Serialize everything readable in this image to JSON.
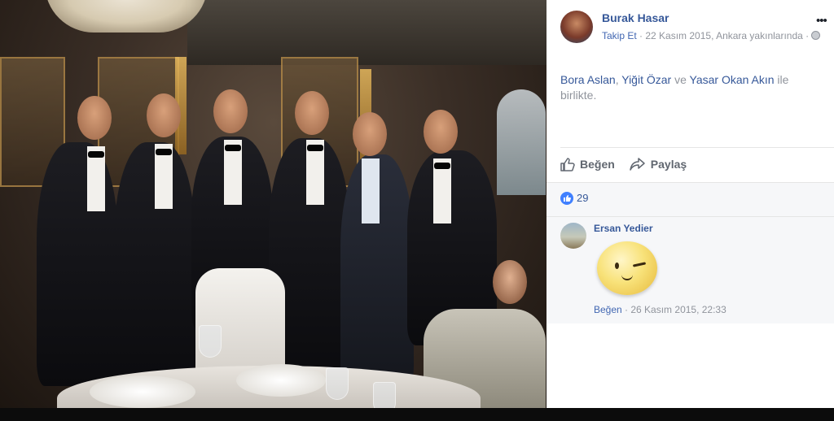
{
  "post": {
    "author": "Burak Hasar",
    "follow": "Takip Et",
    "meta_date": " · 22 Kasım 2015, Ankara yakınlarında · ",
    "more": "•••",
    "text_tag1": "Bora Aslan",
    "text_sep1": ", ",
    "text_tag2": "Yiğit Özar",
    "text_sep2": " ve ",
    "text_tag3": "Yasar Okan Akın",
    "text_suffix": " ile birlikte."
  },
  "actions": {
    "like_label": "Beğen",
    "share_label": "Paylaş"
  },
  "reactions": {
    "like_count": "29"
  },
  "comment": {
    "author": "Ersan Yedier",
    "like_label": "Beğen",
    "timestamp": " · 26 Kasım 2015, 22:33"
  },
  "colors": {
    "link": "#365899",
    "muted": "#90949c",
    "like_blue": "#4080ff"
  },
  "icons": [
    "more-icon",
    "globe-icon",
    "thumbs-up-icon",
    "share-arrow-icon",
    "like-reaction-icon",
    "wink-sticker"
  ]
}
